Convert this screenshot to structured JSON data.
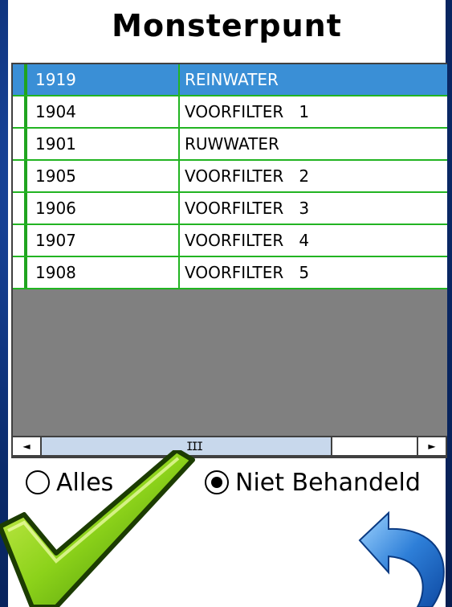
{
  "title": "Monsterpunt",
  "rows": [
    {
      "code": "1919",
      "name": "REINWATER",
      "selected": true
    },
    {
      "code": "1904",
      "name": "VOORFILTER   1",
      "selected": false
    },
    {
      "code": "1901",
      "name": "RUWWATER",
      "selected": false
    },
    {
      "code": "1905",
      "name": "VOORFILTER   2",
      "selected": false
    },
    {
      "code": "1906",
      "name": "VOORFILTER   3",
      "selected": false
    },
    {
      "code": "1907",
      "name": "VOORFILTER   4",
      "selected": false
    },
    {
      "code": "1908",
      "name": "VOORFILTER   5",
      "selected": false
    }
  ],
  "scrollbar": {
    "left_arrow": "◄",
    "right_arrow": "►",
    "grip": "III"
  },
  "filters": {
    "alles_label": "Alles",
    "niet_behandeld_label": "Niet Behandeld",
    "selected": "niet_behandeld"
  },
  "icons": {
    "confirm": "checkmark-icon",
    "back": "undo-arrow-icon"
  },
  "colors": {
    "selected_row": "#3a8fd6",
    "grid_lines": "#22b422",
    "check_green": "#7ccf10",
    "undo_blue": "#2e7fd8"
  }
}
